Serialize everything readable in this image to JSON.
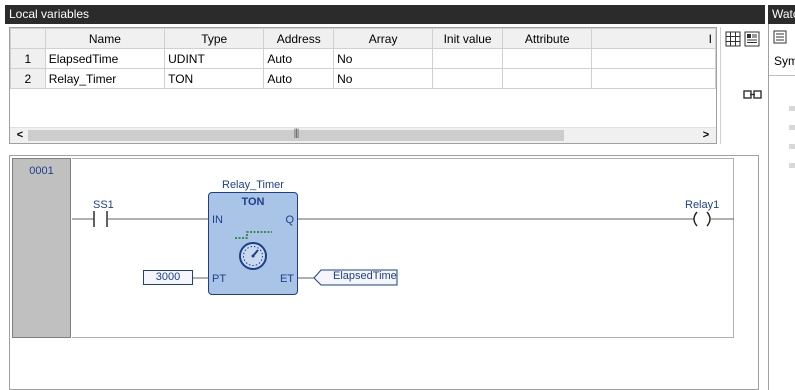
{
  "local_variables": {
    "title": "Local variables",
    "columns": [
      "",
      "Name",
      "Type",
      "Address",
      "Array",
      "Init value",
      "Attribute",
      "I"
    ],
    "rows": [
      {
        "num": "1",
        "name": "ElapsedTime",
        "type": "UDINT",
        "address": "Auto",
        "array": "No"
      },
      {
        "num": "2",
        "name": "Relay_Timer",
        "type": "TON",
        "address": "Auto",
        "array": "No"
      }
    ],
    "scroll": {
      "left": "<",
      "right": ">",
      "grip": "|||"
    }
  },
  "watch": {
    "title": "Watc",
    "tab_label": "Sym"
  },
  "ladder": {
    "rung_number": "0001",
    "contact_label": "SS1",
    "fb_instance": "Relay_Timer",
    "fb_type": "TON",
    "pin_in": "IN",
    "pin_q": "Q",
    "pin_pt": "PT",
    "pin_et": "ET",
    "pt_value": "3000",
    "et_variable": "ElapsedTime",
    "coil_label": "Relay1"
  },
  "colors": {
    "header_bg": "#2b2b2b",
    "fb_fill": "#a9c4e6",
    "ladder_blue": "#1d3f8a",
    "gutter": "#c0c0c0"
  }
}
